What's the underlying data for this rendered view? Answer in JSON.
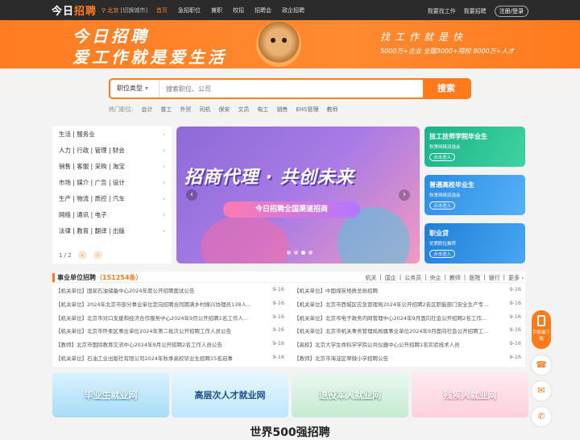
{
  "topbar": {
    "logo": "今日",
    "logo_accent": "招聘",
    "city": "北京",
    "city_switch": "[切换城市]",
    "nav": [
      "首页",
      "急招职位",
      "兼职",
      "校招",
      "招聘会",
      "政企招聘"
    ],
    "find_job": "我要找工作",
    "recruit": "我要招聘",
    "login": "注册/登录"
  },
  "banner": {
    "slogan1": "今日招聘",
    "slogan2": "爱工作就是爱生活",
    "right1": "找工作就是快",
    "right2": "5000万+企业 全国3000+院校 8000万+人才"
  },
  "search": {
    "type_label": "职位类型",
    "placeholder": "搜索职位、公司",
    "button": "搜索"
  },
  "hot": {
    "label": "热门职位:",
    "items": [
      "会计",
      "普工",
      "外贸",
      "司机",
      "保安",
      "文员",
      "电工",
      "销售",
      "EHS管理",
      "教师"
    ]
  },
  "categories": {
    "items": [
      "生活 | 服务业",
      "人力 | 行政 | 管理 | 财会",
      "销售 | 客服 | 采购 | 淘宝",
      "市场 | 媒介 | 广告 | 设计",
      "生产 | 物流 | 质控 | 汽车",
      "网络 | 通讯 | 电子",
      "法律 | 教育 | 翻译 | 出版"
    ],
    "pager": "1 / 2"
  },
  "slider": {
    "headline": "招商代理 · 共创未来",
    "sub": "今日招聘全国渠道招商",
    "prev": "‹",
    "next": "›"
  },
  "promos": [
    {
      "title": "技工技师学院毕业生",
      "sub": "秋季网络双选会",
      "btn": "点击进入"
    },
    {
      "title": "普通高校毕业生",
      "sub": "秋季网络双选会",
      "btn": "点击进入"
    },
    {
      "title": "职业贷",
      "sub": "优质职位推荐",
      "btn": "点击进入"
    }
  ],
  "jobs": {
    "title": "事业单位招聘",
    "count": "（151254条）",
    "links": [
      "机关",
      "国企",
      "公务员",
      "央企",
      "教师",
      "医院",
      "银行",
      "更多 ›"
    ],
    "left": [
      {
        "text": "【机关单位】国家石油储备中心2024年度公开招聘面试公告",
        "date": "9-16"
      },
      {
        "text": "【机关单位】2024年北京市部分事业单位定向招聘合同期满乡村振兴协理员138人...",
        "date": "9-16"
      },
      {
        "text": "【机关单位】北京市对口支援和经济合作服务中心2024年9月公开招聘1名工作人...",
        "date": "9-16"
      },
      {
        "text": "【机关单位】北京市怀柔区事业单位2024年第二批次公开招聘工作人员公告",
        "date": "9-16"
      },
      {
        "text": "【教师】北京市国际教育交流中心2024年9月公开招聘2名工作人员公告",
        "date": "9-16"
      },
      {
        "text": "【机关单位】石油工业出版社有限公司2024年秋季高校毕业生招聘15名启事",
        "date": "9-16"
      }
    ],
    "right": [
      {
        "text": "【机关单位】中国煤炭地质总局招聘",
        "date": "9-16"
      },
      {
        "text": "【机关单位】北京市西城区应急管理局2024年公开招聘2名区职能部门安全生产专...",
        "date": "9-16"
      },
      {
        "text": "【机关单位】北京市电子政务内网管理中心2024年9月面向社会公开招聘2名工作...",
        "date": "9-16"
      },
      {
        "text": "【机关单位】北京市机关事务管理局局属事业单位2024年9月面向社会公开招聘工...",
        "date": "9-16"
      },
      {
        "text": "【高校】北京大学生命科学学院公共仪器中心公开招聘1名实验技术人员",
        "date": "9-16"
      },
      {
        "text": "【教师】北京市海淀区翠微小学招聘公告",
        "date": "9-16"
      }
    ]
  },
  "bottom_banners": [
    "毕业生就业网",
    "高层次人才就业网",
    "退役军人就业网",
    "残疾人就业网"
  ],
  "section_title": "世界500强招聘",
  "float": {
    "app": "手机端下载"
  },
  "colors": {
    "accent": "#ff7a1a",
    "topbar": "#2b2b2b"
  }
}
